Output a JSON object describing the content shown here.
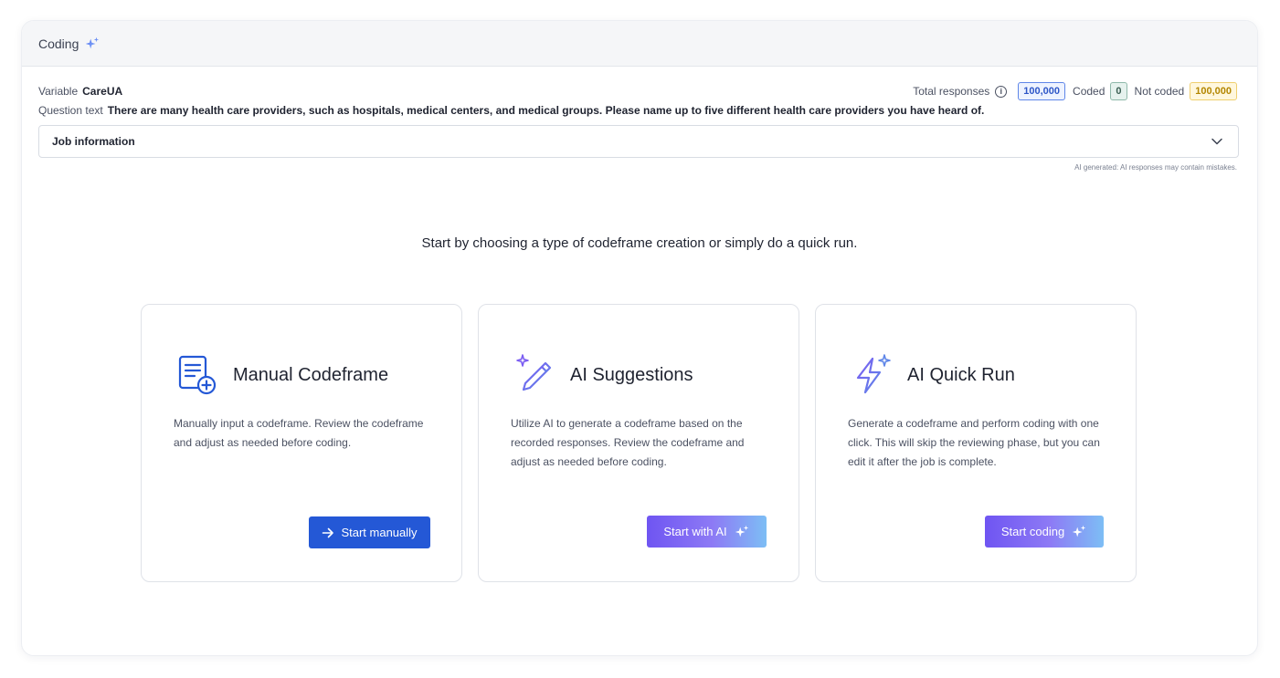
{
  "panel": {
    "title": "Coding",
    "title_icon": "sparkle-icon"
  },
  "meta": {
    "variable_label": "Variable",
    "variable_value": "CareUA",
    "question_label": "Question text",
    "question_value": "There are many health care providers, such as hospitals, medical centers, and medical groups. Please name up to five different health care providers you have heard of.",
    "total_label": "Total responses",
    "total_value": "100,000",
    "coded_label": "Coded",
    "coded_value": "0",
    "not_coded_label": "Not coded",
    "not_coded_value": "100,000"
  },
  "job_dropdown": {
    "label": "Job information"
  },
  "disclaimer": "AI generated: AI responses may contain mistakes.",
  "prompt": "Start by choosing a type of codeframe creation or simply do a quick run.",
  "cards": [
    {
      "title": "Manual Codeframe",
      "icon": "document-plus-icon",
      "description": "Manually input a codeframe. Review the codeframe and adjust as needed before coding.",
      "button_label": "Start manually"
    },
    {
      "title": "AI Suggestions",
      "icon": "pencil-sparkle-icon",
      "description": "Utilize AI to generate a codeframe based on the recorded responses. Review the codeframe and adjust as needed before coding.",
      "button_label": "Start with AI"
    },
    {
      "title": "AI Quick Run",
      "icon": "lightning-sparkle-icon",
      "description": "Generate a codeframe and perform coding with one click. This will skip the reviewing phase, but you can edit it after the job is complete.",
      "button_label": "Start coding"
    }
  ],
  "colors": {
    "primary": "#2458d6",
    "ai_gradient_start": "#6f55f2",
    "ai_gradient_end": "#7dbef5"
  }
}
